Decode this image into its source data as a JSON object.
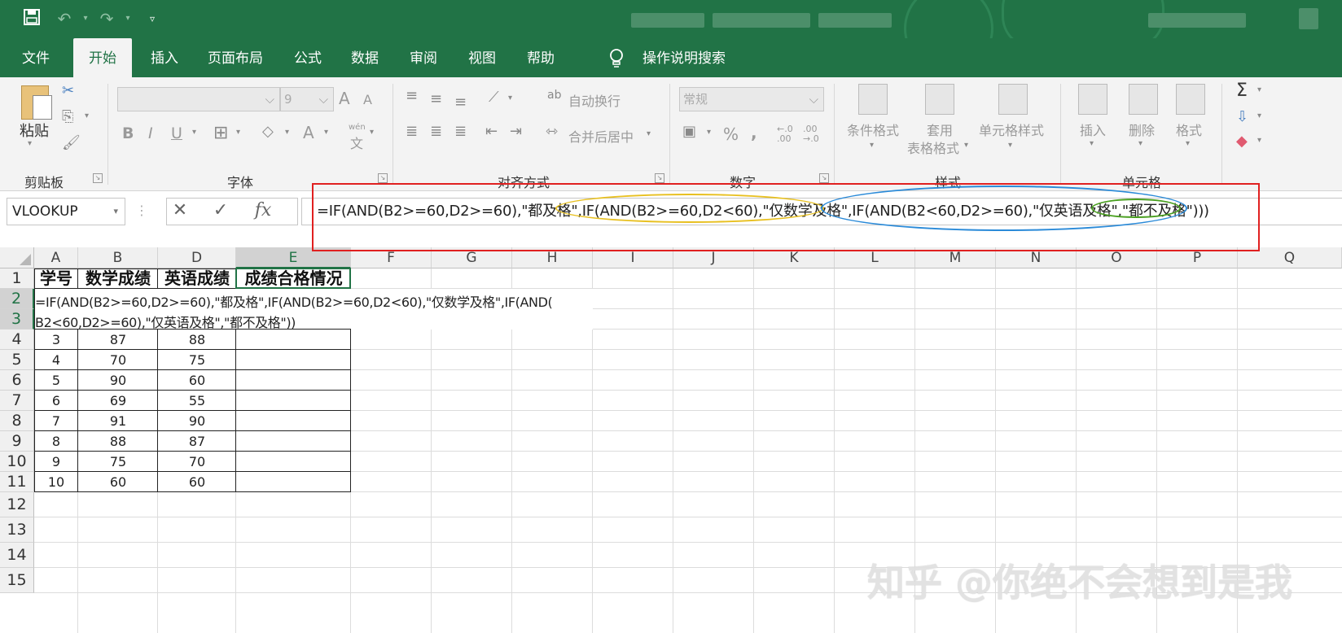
{
  "quick_access": {
    "save_icon": "save-icon",
    "undo_icon": "undo-icon",
    "redo_icon": "redo-icon",
    "customize_icon": "customize-icon"
  },
  "tabs": [
    "文件",
    "开始",
    "插入",
    "页面布局",
    "公式",
    "数据",
    "审阅",
    "视图",
    "帮助"
  ],
  "tell_me": "操作说明搜索",
  "ribbon": {
    "paste": "粘贴",
    "clipboard": "剪贴板",
    "font_group": "字体",
    "font_size": "9",
    "align_group": "对齐方式",
    "wrap_text": "自动换行",
    "merge_center": "合并后居中",
    "number_group": "数字",
    "number_format": "常规",
    "styles_group": "样式",
    "cond_format": "条件格式",
    "table_format_1": "套用",
    "table_format_2": "表格格式",
    "cell_styles": "单元格样式",
    "cells_group": "单元格",
    "insert": "插入",
    "delete": "删除",
    "format": "格式",
    "bold": "B",
    "italic": "I",
    "underline": "U",
    "font_color": "A",
    "wen": "wén",
    "wen_char": "文",
    "grow_font": "A",
    "shrink_font": "A",
    "percent": "%",
    "comma": ",",
    "dec_inc": "←.0 .00",
    "dec_dec": ".00 →.0",
    "sigma": "Σ"
  },
  "formula_bar": {
    "name_box": "VLOOKUP",
    "fx": "fx",
    "formula": "=IF(AND(B2>=60,D2>=60),\"都及格\",IF(AND(B2>=60,D2<60),\"仅数学及格\",IF(AND(B2<60,D2>=60),\"仅英语及格\",\"都不及格\")))"
  },
  "columns": [
    "A",
    "B",
    "D",
    "E",
    "F",
    "G",
    "H",
    "I",
    "J",
    "K",
    "L",
    "M",
    "N",
    "O",
    "P",
    "Q"
  ],
  "rows": [
    "1",
    "2",
    "3",
    "4",
    "5",
    "6",
    "7",
    "8",
    "9",
    "10",
    "11",
    "12",
    "13",
    "14",
    "15"
  ],
  "headers": [
    "学号",
    "数学成绩",
    "英语成绩",
    "成绩合格情况"
  ],
  "edit_line_1": "=IF(AND(B2>=60,D2>=60),\"都及格\",IF(AND(B2>=60,D2<60),\"仅数学及格\",IF(AND(",
  "edit_line_2": "B2<60,D2>=60),\"仅英语及格\",\"都不及格\"))",
  "data_rows": [
    {
      "id": "3",
      "math": "87",
      "eng": "88"
    },
    {
      "id": "4",
      "math": "70",
      "eng": "75"
    },
    {
      "id": "5",
      "math": "90",
      "eng": "60"
    },
    {
      "id": "6",
      "math": "69",
      "eng": "55"
    },
    {
      "id": "7",
      "math": "91",
      "eng": "90"
    },
    {
      "id": "8",
      "math": "88",
      "eng": "87"
    },
    {
      "id": "9",
      "math": "75",
      "eng": "70"
    },
    {
      "id": "10",
      "math": "60",
      "eng": "60"
    }
  ],
  "watermark": "知乎 @你绝不会想到是我",
  "colors": {
    "excel_green": "#217346",
    "annotation_red": "#e02020",
    "ellipse_yellow": "#e8c020",
    "ellipse_blue": "#2a8ad8",
    "ellipse_green": "#4aa020"
  }
}
